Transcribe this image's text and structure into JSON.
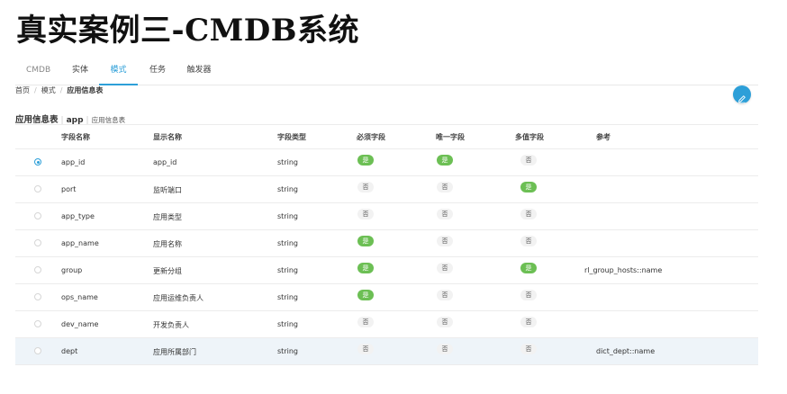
{
  "slide_title": "真实案例三-CMDB系统",
  "tabs": [
    {
      "label": "CMDB",
      "active": false
    },
    {
      "label": "实体",
      "active": false
    },
    {
      "label": "模式",
      "active": true
    },
    {
      "label": "任务",
      "active": false
    },
    {
      "label": "触发器",
      "active": false
    }
  ],
  "breadcrumb": [
    "首页",
    "模式",
    "应用信息表"
  ],
  "section": {
    "title": "应用信息表",
    "code": "app",
    "subtitle": "应用信息表"
  },
  "colors": {
    "accent": "#2d9fd8",
    "yes_badge": "#6cbf54",
    "no_badge": "#f2f2f2",
    "selected_row": "#eef4f9"
  },
  "edit_button_icon": "pencil-icon",
  "table": {
    "headers": [
      "字段名称",
      "显示名称",
      "字段类型",
      "必须字段",
      "唯一字段",
      "多值字段",
      "参考"
    ],
    "rows": [
      {
        "field": "app_id",
        "display": "app_id",
        "type": "string",
        "required": "是",
        "unique": "是",
        "multi": "否",
        "ref": "",
        "checked": true
      },
      {
        "field": "port",
        "display": "监听端口",
        "type": "string",
        "required": "否",
        "unique": "否",
        "multi": "是",
        "ref": "",
        "checked": false
      },
      {
        "field": "app_type",
        "display": "应用类型",
        "type": "string",
        "required": "否",
        "unique": "否",
        "multi": "否",
        "ref": "",
        "checked": false
      },
      {
        "field": "app_name",
        "display": "应用名称",
        "type": "string",
        "required": "是",
        "unique": "否",
        "multi": "否",
        "ref": "",
        "checked": false
      },
      {
        "field": "group",
        "display": "更新分组",
        "type": "string",
        "required": "是",
        "unique": "否",
        "multi": "是",
        "ref": "rl_group_hosts::name",
        "checked": false
      },
      {
        "field": "ops_name",
        "display": "应用运维负责人",
        "type": "string",
        "required": "是",
        "unique": "否",
        "multi": "否",
        "ref": "",
        "checked": false
      },
      {
        "field": "dev_name",
        "display": "开发负责人",
        "type": "string",
        "required": "否",
        "unique": "否",
        "multi": "否",
        "ref": "",
        "checked": false
      },
      {
        "field": "dept",
        "display": "应用所属部门",
        "type": "string",
        "required": "否",
        "unique": "否",
        "multi": "否",
        "ref": "dict_dept::name",
        "checked": false
      }
    ]
  }
}
